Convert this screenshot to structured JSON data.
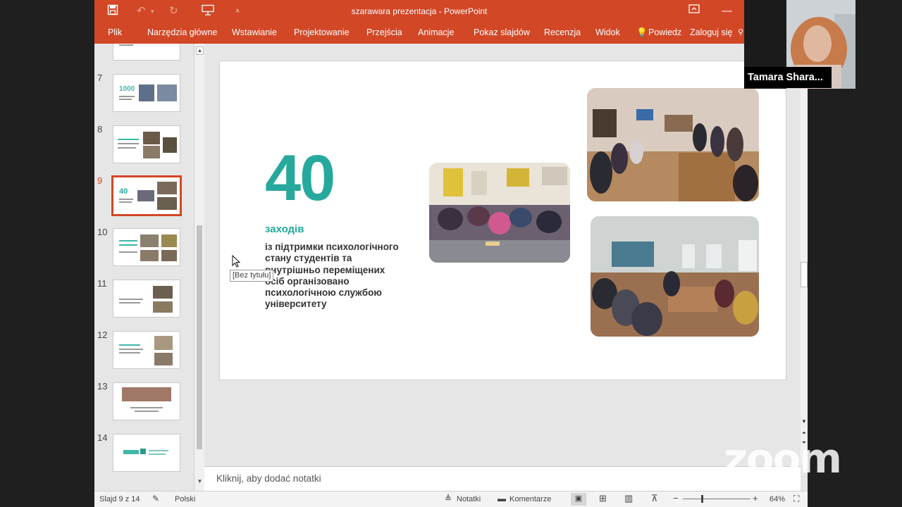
{
  "window": {
    "title": "szarawara prezentacja - PowerPoint"
  },
  "ribbon": {
    "tabs": [
      "Plik",
      "Narzędzia główne",
      "Wstawianie",
      "Projektowanie",
      "Przejścia",
      "Animacje",
      "Pokaz slajdów",
      "Recenzja",
      "Widok"
    ],
    "tell_me": "Powiedz i",
    "signin": "Zaloguj się"
  },
  "thumbnails": {
    "numbers": [
      "7",
      "8",
      "9",
      "10",
      "11",
      "12",
      "13",
      "14"
    ],
    "active": "9",
    "tooltip": "[Bez tytułu]",
    "t7_text": "1000",
    "t9_text": "40"
  },
  "slide": {
    "big_number": "40",
    "subtitle": "заходів",
    "description": "із підтримки психологічного стану студентів та внутрішньо переміщених осіб організовано психологічною службою університету"
  },
  "notes": {
    "placeholder": "Kliknij, aby dodać notatki"
  },
  "status": {
    "slide_info": "Slajd 9 z 14",
    "language": "Polski",
    "notes_label": "Notatki",
    "comments_label": "Komentarze",
    "zoom_level": "64%"
  },
  "video": {
    "participant_name": "Tamara Shara..."
  },
  "zoom_brand": "zoom",
  "colors": {
    "accent": "#d24726",
    "teal": "#26a99c"
  }
}
